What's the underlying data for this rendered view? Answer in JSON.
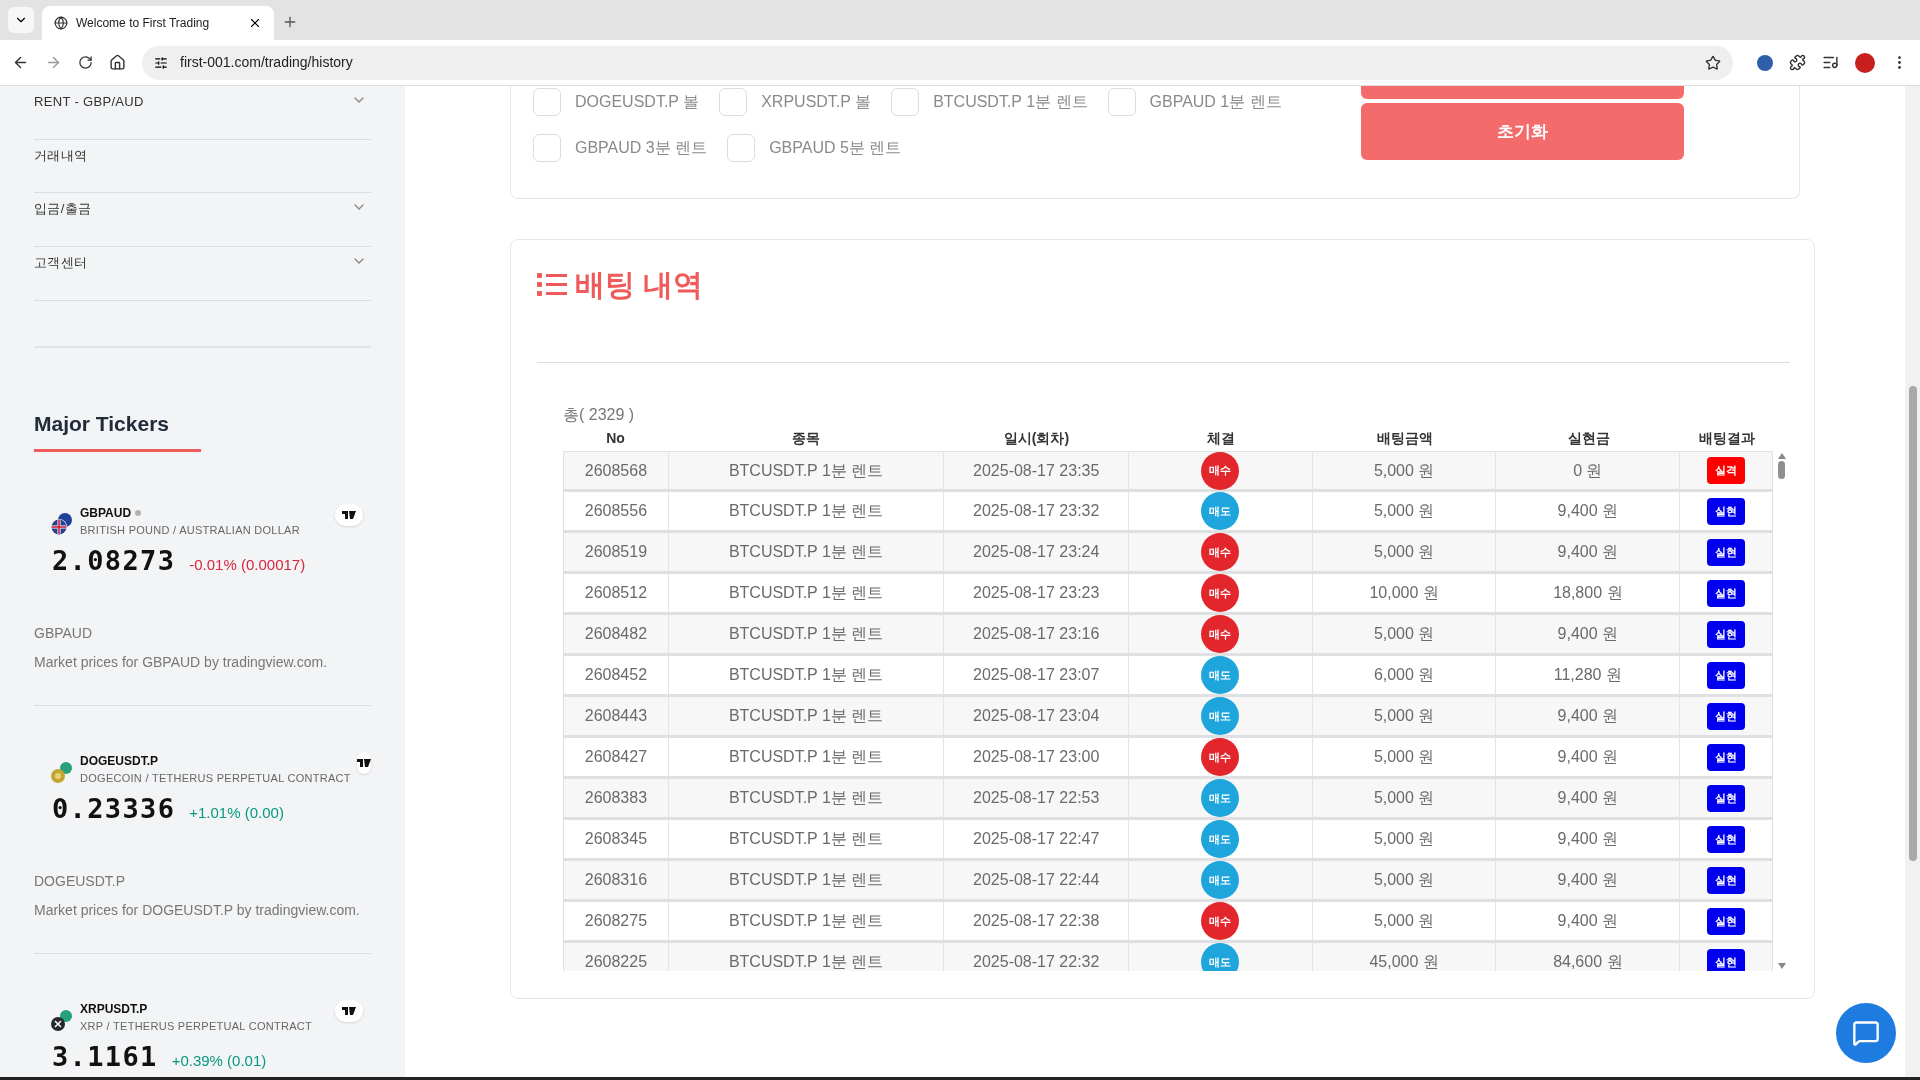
{
  "browser": {
    "tab_title": "Welcome to First Trading",
    "url": "first-001.com/trading/history"
  },
  "sidebar": {
    "menu": [
      {
        "label": "RENT - GBP/AUD",
        "expandable": true
      },
      {
        "label": "거래내역",
        "expandable": false
      },
      {
        "label": "입금/출금",
        "expandable": true
      },
      {
        "label": "고객센터",
        "expandable": true
      }
    ],
    "tickers_title": "Major Tickers",
    "tickers": [
      {
        "kind": "flag",
        "symbol": "GBPAUD",
        "market_dot": true,
        "name": "BRITISH POUND / AUSTRALIAN DOLLAR",
        "price": "2.08273",
        "change": "-0.01% (0.00017)",
        "color": "#d7263d",
        "note_title": "GBPAUD",
        "note_text": "Market prices for GBPAUD by tradingview.com."
      },
      {
        "kind": "doge",
        "symbol": "DOGEUSDT.P",
        "market_dot": false,
        "name": "DOGECOIN / TETHERUS PERPETUAL CONTRACT",
        "price": "0.23336",
        "change": "+1.01% (0.00)",
        "color": "#089981",
        "note_title": "DOGEUSDT.P",
        "note_text": "Market prices for DOGEUSDT.P by tradingview.com."
      },
      {
        "kind": "xrp",
        "symbol": "XRPUSDT.P",
        "market_dot": false,
        "name": "XRP / TETHERUS PERPETUAL CONTRACT",
        "price": "3.1161",
        "change": "+0.39% (0.01)",
        "color": "#089981"
      }
    ]
  },
  "filters": {
    "options": [
      {
        "label": "DOGEUSDT.P 볼",
        "checked": false
      },
      {
        "label": "XRPUSDT.P 볼",
        "checked": false
      },
      {
        "label": "BTCUSDT.P 1분 렌트",
        "checked": false
      },
      {
        "label": "GBPAUD 1분 렌트",
        "checked": false
      },
      {
        "label": "GBPAUD 3분 렌트",
        "checked": false
      },
      {
        "label": "GBPAUD 5분 렌트",
        "checked": false
      }
    ],
    "reset_button": "초기화"
  },
  "history": {
    "title": "배팅 내역",
    "total": "총( 2329 )",
    "columns": [
      "No",
      "종목",
      "일시(회차)",
      "체결",
      "배팅금액",
      "실현금",
      "배팅결과"
    ],
    "rows": [
      {
        "no": "2608568",
        "item": "BTCUSDT.P 1분 렌트",
        "time": "2025-08-17 23:35",
        "side": {
          "kind": "buy",
          "label": "매수"
        },
        "amount": "5,000 원",
        "payout": "0 원",
        "result": {
          "kind": "loss",
          "label": "실격"
        }
      },
      {
        "no": "2608556",
        "item": "BTCUSDT.P 1분 렌트",
        "time": "2025-08-17 23:32",
        "side": {
          "kind": "sell",
          "label": "매도"
        },
        "amount": "5,000 원",
        "payout": "9,400 원",
        "result": {
          "kind": "win",
          "label": "실현"
        }
      },
      {
        "no": "2608519",
        "item": "BTCUSDT.P 1분 렌트",
        "time": "2025-08-17 23:24",
        "side": {
          "kind": "buy",
          "label": "매수"
        },
        "amount": "5,000 원",
        "payout": "9,400 원",
        "result": {
          "kind": "win",
          "label": "실현"
        }
      },
      {
        "no": "2608512",
        "item": "BTCUSDT.P 1분 렌트",
        "time": "2025-08-17 23:23",
        "side": {
          "kind": "buy",
          "label": "매수"
        },
        "amount": "10,000 원",
        "payout": "18,800 원",
        "result": {
          "kind": "win",
          "label": "실현"
        }
      },
      {
        "no": "2608482",
        "item": "BTCUSDT.P 1분 렌트",
        "time": "2025-08-17 23:16",
        "side": {
          "kind": "buy",
          "label": "매수"
        },
        "amount": "5,000 원",
        "payout": "9,400 원",
        "result": {
          "kind": "win",
          "label": "실현"
        }
      },
      {
        "no": "2608452",
        "item": "BTCUSDT.P 1분 렌트",
        "time": "2025-08-17 23:07",
        "side": {
          "kind": "sell",
          "label": "매도"
        },
        "amount": "6,000 원",
        "payout": "11,280 원",
        "result": {
          "kind": "win",
          "label": "실현"
        }
      },
      {
        "no": "2608443",
        "item": "BTCUSDT.P 1분 렌트",
        "time": "2025-08-17 23:04",
        "side": {
          "kind": "sell",
          "label": "매도"
        },
        "amount": "5,000 원",
        "payout": "9,400 원",
        "result": {
          "kind": "win",
          "label": "실현"
        }
      },
      {
        "no": "2608427",
        "item": "BTCUSDT.P 1분 렌트",
        "time": "2025-08-17 23:00",
        "side": {
          "kind": "buy",
          "label": "매수"
        },
        "amount": "5,000 원",
        "payout": "9,400 원",
        "result": {
          "kind": "win",
          "label": "실현"
        }
      },
      {
        "no": "2608383",
        "item": "BTCUSDT.P 1분 렌트",
        "time": "2025-08-17 22:53",
        "side": {
          "kind": "sell",
          "label": "매도"
        },
        "amount": "5,000 원",
        "payout": "9,400 원",
        "result": {
          "kind": "win",
          "label": "실현"
        }
      },
      {
        "no": "2608345",
        "item": "BTCUSDT.P 1분 렌트",
        "time": "2025-08-17 22:47",
        "side": {
          "kind": "sell",
          "label": "매도"
        },
        "amount": "5,000 원",
        "payout": "9,400 원",
        "result": {
          "kind": "win",
          "label": "실현"
        }
      },
      {
        "no": "2608316",
        "item": "BTCUSDT.P 1분 렌트",
        "time": "2025-08-17 22:44",
        "side": {
          "kind": "sell",
          "label": "매도"
        },
        "amount": "5,000 원",
        "payout": "9,400 원",
        "result": {
          "kind": "win",
          "label": "실현"
        }
      },
      {
        "no": "2608275",
        "item": "BTCUSDT.P 1분 렌트",
        "time": "2025-08-17 22:38",
        "side": {
          "kind": "buy",
          "label": "매수"
        },
        "amount": "5,000 원",
        "payout": "9,400 원",
        "result": {
          "kind": "win",
          "label": "실현"
        }
      },
      {
        "no": "2608225",
        "item": "BTCUSDT.P 1분 렌트",
        "time": "2025-08-17 22:32",
        "side": {
          "kind": "sell",
          "label": "매도"
        },
        "amount": "45,000 원",
        "payout": "84,600 원",
        "result": {
          "kind": "win",
          "label": "실현"
        }
      }
    ]
  }
}
